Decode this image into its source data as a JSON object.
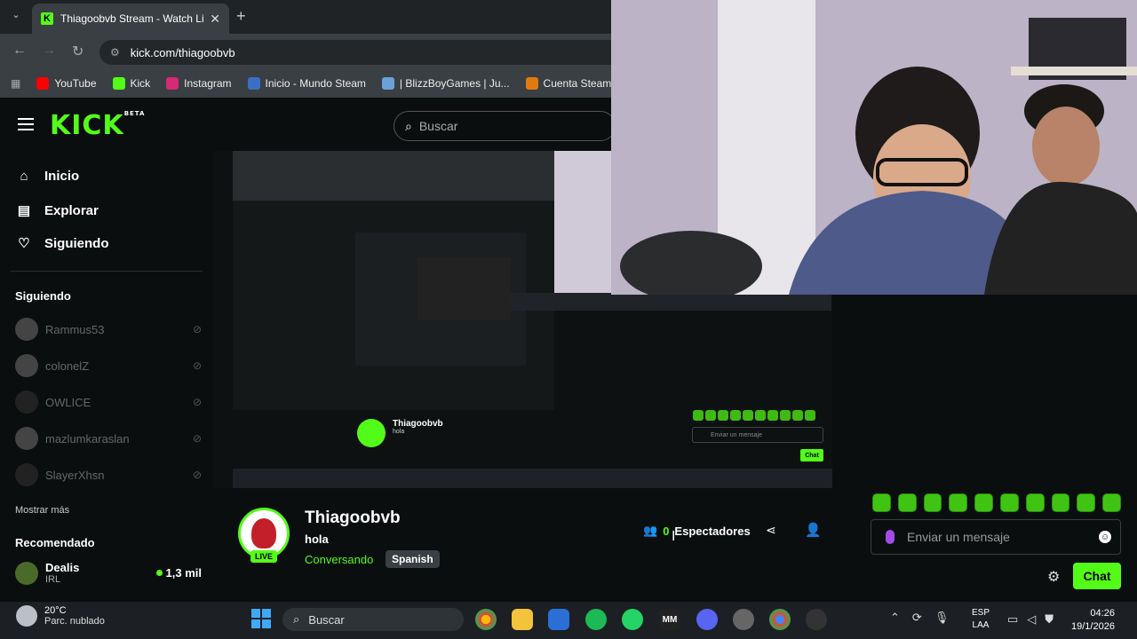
{
  "browser": {
    "tab_title": "Thiagoobvb Stream - Watch Li",
    "tab_close": "✕",
    "new_tab": "+",
    "tab_menu": "⌄",
    "url": "kick.com/thiagoobvb",
    "bookmarks": [
      {
        "label": "YouTube",
        "color": "#ff0000"
      },
      {
        "label": "Kick",
        "color": "#53fc18"
      },
      {
        "label": "Instagram",
        "color": "#d62976"
      },
      {
        "label": "Inicio - Mundo Steam",
        "color": "#3a6fc4"
      },
      {
        "label": "| BlizzBoyGames | Ju...",
        "color": "#6aa2d8"
      },
      {
        "label": "Cuenta Steam - Gu",
        "color": "#e07a10"
      }
    ]
  },
  "kick": {
    "logo": "KICK",
    "logo_sup": "BETA",
    "search_placeholder": "Buscar",
    "nav": [
      {
        "label": "Inicio",
        "icon": "home-icon"
      },
      {
        "label": "Explorar",
        "icon": "browse-icon"
      },
      {
        "label": "Siguiendo",
        "icon": "heart-icon"
      }
    ],
    "following_title": "Siguiendo",
    "following": [
      "Rammus53",
      "colonelZ",
      "OWLICE",
      "mazlumkaraslan",
      "SlayerXhsn"
    ],
    "show_more": "Mostrar más",
    "recommended_title": "Recomendado",
    "recommended": {
      "name": "Dealis",
      "category": "IRL",
      "viewers": "1,3 mil"
    }
  },
  "nested": {
    "streamer": "Thiagoobvb",
    "title": "hola",
    "message_placeholder": "Enviar un mensaje",
    "chat_button": "Chat"
  },
  "stream": {
    "streamer": "Thiagoobvb",
    "live": "LIVE",
    "title": "hola",
    "category": "Conversando",
    "language": "Spanish",
    "viewers_count": "0",
    "viewers_label": "Espectadores"
  },
  "chat": {
    "message_placeholder": "Enviar un mensaje",
    "chat_button": "Chat"
  },
  "taskbar": {
    "temp": "20°C",
    "weather": "Parc. nublado",
    "search": "Buscar",
    "lang_line1": "ESP",
    "lang_line2": "LAA",
    "time": "04:26",
    "date": "19/1/2026"
  },
  "colors": {
    "accent": "#53fc18",
    "background": "#0b0e0f"
  }
}
